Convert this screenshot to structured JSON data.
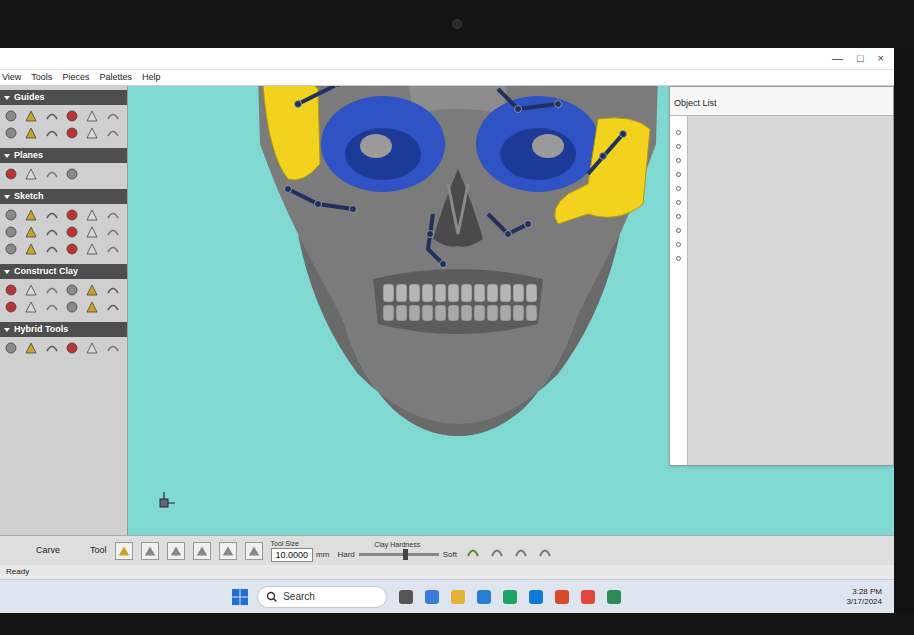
{
  "window": {
    "controls": [
      "—",
      "□",
      "×"
    ]
  },
  "menu": [
    "View",
    "Tools",
    "Pieces",
    "Palettes",
    "Help"
  ],
  "palette": {
    "sections": [
      {
        "title": "Guides"
      },
      {
        "title": "Planes"
      },
      {
        "title": "Sketch"
      },
      {
        "title": "Construct Clay"
      },
      {
        "title": "Hybrid Tools"
      }
    ]
  },
  "object_list": {
    "title": "Object List"
  },
  "toolbar": {
    "left_label": "Carve",
    "tool_label": "Tool",
    "size_label": "Tool Size",
    "size_value": "10.0000",
    "size_unit": "mm",
    "hardness_label": "Clay Hardness",
    "hard": "Hard",
    "soft": "Soft",
    "hardness_level": 0.55
  },
  "status": {
    "text": "Ready"
  },
  "taskbar": {
    "search": "Search",
    "time": "3:28 PM",
    "date": "3/17/2024"
  }
}
